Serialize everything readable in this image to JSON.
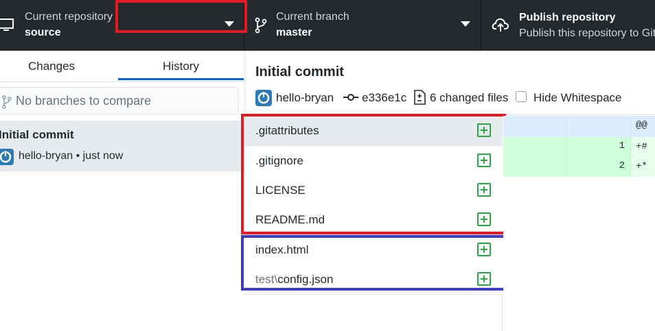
{
  "toolbar": {
    "repository": {
      "label": "Current repository",
      "value": "source"
    },
    "branch": {
      "label": "Current branch",
      "value": "master"
    },
    "publish": {
      "title": "Publish repository",
      "subtitle": "Publish this repository to GitHub"
    }
  },
  "sidebar": {
    "tabs": [
      {
        "label": "Changes"
      },
      {
        "label": "History",
        "selected": true
      }
    ],
    "branch_filter": {
      "placeholder": "No branches to compare",
      "value": ""
    },
    "commits": [
      {
        "summary": "Initial commit",
        "meta": "hello-bryan • just now"
      }
    ]
  },
  "commit": {
    "title": "Initial commit",
    "author": "hello-bryan",
    "sha": "e336e1c",
    "changed_files": "6 changed files",
    "hide_whitespace_label": "Hide Whitespace",
    "hide_whitespace_checked": false
  },
  "files": [
    {
      "name": ".gitattributes",
      "dir": "",
      "status": "added"
    },
    {
      "name": ".gitignore",
      "dir": "",
      "status": "added"
    },
    {
      "name": "LICENSE",
      "dir": "",
      "status": "added"
    },
    {
      "name": "README.md",
      "dir": "",
      "status": "added"
    },
    {
      "name": "index.html",
      "dir": "",
      "status": "added"
    },
    {
      "name": "config.json",
      "dir": "test\\",
      "status": "added"
    }
  ],
  "diff": {
    "hunk": "@@",
    "lines": [
      {
        "new_no": "1",
        "text": "+#"
      },
      {
        "new_no": "2",
        "text": "+*"
      }
    ]
  },
  "colors": {
    "toolbar_bg": "#24292e",
    "accent_blue": "#0366d6",
    "added_green": "#28a745",
    "annotation_red": "#e31b23",
    "annotation_blue": "#3c3cc7"
  }
}
